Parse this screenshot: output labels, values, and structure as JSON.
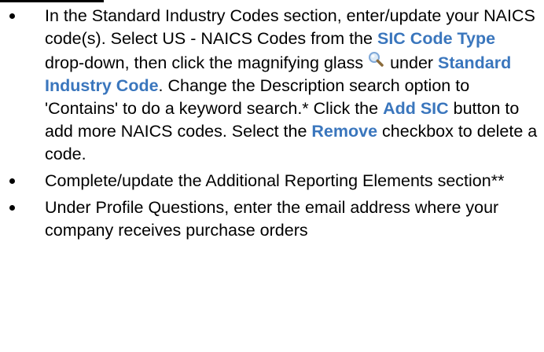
{
  "items": [
    {
      "p1": "In the Standard Industry Codes section, enter/update your NAICS code(s). Select US - NAICS Codes from the ",
      "h1": "SIC Code Type",
      "p2": " drop-down, then click the magnifying glass ",
      "icon": "magnifying-glass-icon",
      "p3": " under ",
      "h2": "Standard Industry Code",
      "p4": ". Change the Description search option to 'Contains' to do a keyword search.* Click the ",
      "h3": "Add SIC",
      "p5": " button to add more NAICS codes. Select the ",
      "h4": "Remove",
      "p6": " checkbox to delete a code."
    },
    {
      "text": "Complete/update the Additional Reporting Elements section**"
    },
    {
      "text": "Under Profile Questions, enter the email address where your company receives purchase orders"
    }
  ],
  "colors": {
    "highlight": "#3a76bd",
    "text": "#000000",
    "icon_lens": "#7fa8d8"
  }
}
